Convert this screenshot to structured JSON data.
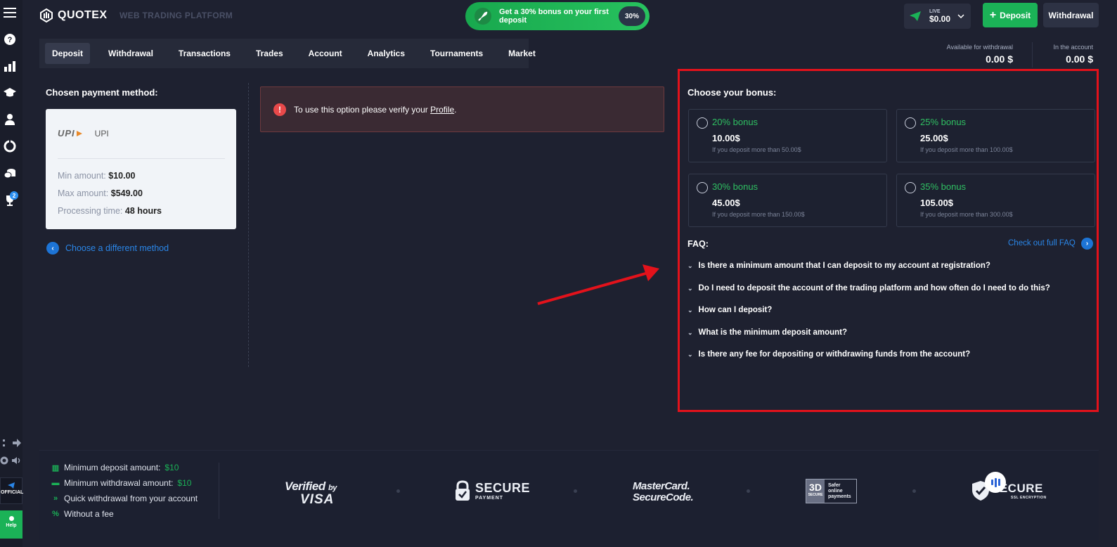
{
  "header": {
    "brand": "QUOTEX",
    "platform": "WEB TRADING PLATFORM",
    "promo_text": "Get a 30% bonus on your first deposit",
    "promo_badge": "30%",
    "account_type": "LIVE",
    "account_balance": "$0.00",
    "deposit_label": "Deposit",
    "withdrawal_label": "Withdrawal"
  },
  "sidebar": {
    "icons": [
      "menu-icon",
      "help-icon",
      "chart-icon",
      "education-icon",
      "profile-icon",
      "analytics-icon",
      "coins-icon",
      "trophy-icon"
    ],
    "trophy_badge": "2",
    "official_label": "OFFICIAL",
    "help_label": "Help"
  },
  "tabs": [
    {
      "label": "Deposit",
      "active": true
    },
    {
      "label": "Withdrawal"
    },
    {
      "label": "Transactions"
    },
    {
      "label": "Trades"
    },
    {
      "label": "Account"
    },
    {
      "label": "Analytics"
    },
    {
      "label": "Tournaments"
    },
    {
      "label": "Market"
    }
  ],
  "balances": {
    "available_label": "Available for withdrawal",
    "available_value": "0.00 $",
    "account_label": "In the account",
    "account_value": "0.00 $"
  },
  "payment": {
    "title": "Chosen payment method:",
    "method_logo": "UPI",
    "method_name": "UPI",
    "min_label": "Min amount:",
    "min_value": "$10.00",
    "max_label": "Max amount:",
    "max_value": "$549.00",
    "time_label": "Processing time:",
    "time_value": "48 hours",
    "change_label": "Choose a different method"
  },
  "alert": {
    "text": "To use this option please verify your",
    "link": "Profile",
    "suffix": "."
  },
  "bonus": {
    "title": "Choose your bonus:",
    "options": [
      {
        "pct": "20% bonus",
        "amount": "10.00$",
        "condition": "If you deposit more than 50.00$"
      },
      {
        "pct": "25% bonus",
        "amount": "25.00$",
        "condition": "If you deposit more than 100.00$"
      },
      {
        "pct": "30% bonus",
        "amount": "45.00$",
        "condition": "If you deposit more than 150.00$"
      },
      {
        "pct": "35% bonus",
        "amount": "105.00$",
        "condition": "If you deposit more than 300.00$"
      }
    ]
  },
  "faq": {
    "title": "FAQ:",
    "link": "Check out full FAQ",
    "questions": [
      "Is there a minimum amount that I can deposit to my account at registration?",
      "Do I need to deposit the account of the trading platform and how often do I need to do this?",
      "How can I deposit?",
      "What is the minimum deposit amount?",
      "Is there any fee for depositing or withdrawing funds from the account?"
    ]
  },
  "footer": {
    "features": [
      {
        "icon": "bank-icon",
        "text": "Minimum deposit amount:",
        "value": "$10"
      },
      {
        "icon": "card-icon",
        "text": "Minimum withdrawal amount:",
        "value": "$10"
      },
      {
        "icon": "fast-forward-icon",
        "text": "Quick withdrawal from your account",
        "value": ""
      },
      {
        "icon": "percent-icon",
        "text": "Without a fee",
        "value": ""
      }
    ],
    "certs": {
      "visa_top": "Verified",
      "visa_by": "by",
      "visa_brand": "VISA",
      "secure_top": "SECURE",
      "secure_sub": "PAYMENT",
      "mc_top": "MasterCard.",
      "mc_sub": "SecureCode.",
      "ds_badge": "3D",
      "ds_badge_sub": "SECURE",
      "ds_text1": "Safer",
      "ds_text2": "online",
      "ds_text3": "payments",
      "ssl_top": "SECURE",
      "ssl_sub": "SSL ENCRYPTION"
    }
  },
  "colors": {
    "accent_green": "#1bb257",
    "link_blue": "#2a86e8",
    "highlight_red": "#e3121b"
  }
}
